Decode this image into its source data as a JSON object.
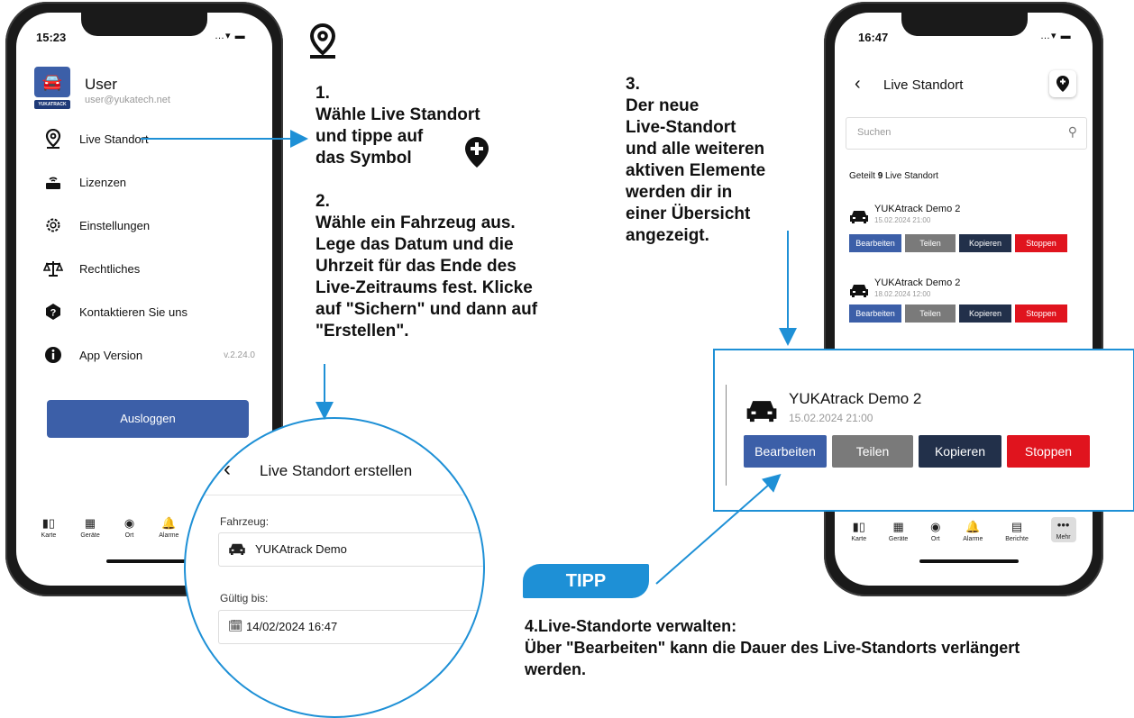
{
  "left_phone": {
    "time": "15:23",
    "user_name": "User",
    "user_email": "user@yukatech.net",
    "logo_caption": "YUKATRACK",
    "menu": [
      {
        "label": "Live Standort",
        "icon": "location-pin-icon"
      },
      {
        "label": "Lizenzen",
        "icon": "router-icon"
      },
      {
        "label": "Einstellungen",
        "icon": "gear-icon"
      },
      {
        "label": "Rechtliches",
        "icon": "scales-icon"
      },
      {
        "label": "Kontaktieren Sie uns",
        "icon": "question-icon"
      },
      {
        "label": "App Version",
        "icon": "info-icon"
      }
    ],
    "app_version": "v.2.24.0",
    "logout_label": "Ausloggen",
    "tabs": [
      "Karte",
      "Geräte",
      "Ort",
      "Alarme"
    ]
  },
  "steps": {
    "step1_num": "1.",
    "step1_lines": [
      "Wähle Live Standort",
      "und tippe auf",
      "das Symbol"
    ],
    "step2_num": "2.",
    "step2_lines": [
      "Wähle ein Fahrzeug aus.",
      "Lege das Datum und die",
      "Uhrzeit für das Ende des",
      "Live-Zeitraums fest. Klicke",
      "auf  \"Sichern\" und dann auf",
      "\"Erstellen\"."
    ],
    "step3_num": "3.",
    "step3_lines": [
      "Der neue",
      "Live-Standort",
      "und alle weiteren",
      "aktiven Elemente",
      "werden dir in",
      "einer Übersicht",
      "angezeigt."
    ]
  },
  "create_zoom": {
    "title": "Live Standort erstellen",
    "vehicle_label": "Fahrzeug:",
    "vehicle_value": "YUKAtrack Demo",
    "valid_label": "Gültig bis:",
    "valid_value": "14/02/2024 16:47"
  },
  "right_phone": {
    "time": "16:47",
    "title": "Live Standort",
    "search_placeholder": "Suchen",
    "shared_prefix": "Geteilt ",
    "shared_count": "9",
    "shared_suffix": " Live Standort",
    "items": [
      {
        "name": "YUKAtrack Demo 2",
        "date": "15.02.2024 21:00"
      },
      {
        "name": "YUKAtrack Demo 2",
        "date": "18.02.2024 12:00"
      }
    ],
    "buttons": {
      "edit": "Bearbeiten",
      "share": "Teilen",
      "copy": "Kopieren",
      "stop": "Stoppen"
    },
    "tabs": [
      "Karte",
      "Geräte",
      "Ort",
      "Alarme",
      "Berichte",
      "Mehr"
    ]
  },
  "detail_zoom": {
    "name": "YUKAtrack Demo 2",
    "date": "15.02.2024 21:00"
  },
  "tip": {
    "badge": "TIPP",
    "heading": "4.Live-Standorte verwalten:",
    "line1": "Über \"Bearbeiten\" kann die Dauer des Live-Standorts verlängert",
    "line2": "werden."
  },
  "colors": {
    "blue": "#3c5fa8",
    "gray": "#7a7a7a",
    "navy": "#22304a",
    "red": "#e0141e",
    "accent": "#1e90d6"
  }
}
